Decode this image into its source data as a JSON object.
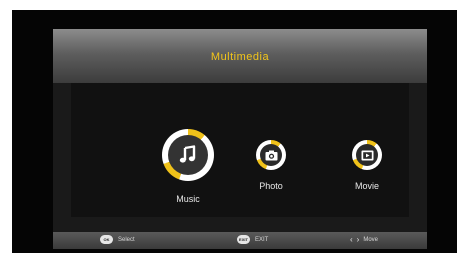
{
  "header": {
    "title": "Multimedia"
  },
  "menu": {
    "items": [
      {
        "label": "Music",
        "icon": "music-note-icon",
        "selected": true
      },
      {
        "label": "Photo",
        "icon": "camera-icon",
        "selected": false
      },
      {
        "label": "Movie",
        "icon": "film-icon",
        "selected": false
      }
    ]
  },
  "footer": {
    "select": {
      "key": "OK",
      "label": "Select"
    },
    "exit": {
      "key": "EXIT",
      "label": "EXIT"
    },
    "move": {
      "left_arrow": "‹",
      "right_arrow": "›",
      "label": "Move"
    }
  },
  "colors": {
    "accent": "#f0c21a",
    "header_bg": "#6e6e6e",
    "screen_bg": "#050505"
  }
}
